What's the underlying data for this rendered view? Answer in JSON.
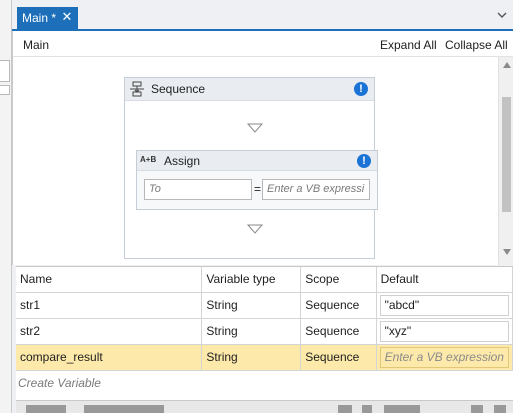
{
  "tab": {
    "label": "Main *"
  },
  "designer": {
    "breadcrumb": "Main",
    "expand_all": "Expand All",
    "collapse_all": "Collapse All"
  },
  "sequence": {
    "title": "Sequence",
    "assign": {
      "title": "Assign",
      "icon_text": "A+B",
      "to_placeholder": "To",
      "equals": "=",
      "value_placeholder": "Enter a VB expressi"
    }
  },
  "variables": {
    "columns": [
      "Name",
      "Variable type",
      "Scope",
      "Default"
    ],
    "rows": [
      {
        "name": "str1",
        "type": "String",
        "scope": "Sequence",
        "default": "\"abcd\""
      },
      {
        "name": "str2",
        "type": "String",
        "scope": "Sequence",
        "default": "\"xyz\""
      },
      {
        "name": "compare_result",
        "type": "String",
        "scope": "Sequence",
        "default": "Enter a VB expression"
      }
    ],
    "create_variable": "Create Variable"
  },
  "colors": {
    "accent": "#1c6fb8",
    "selected_row": "#fde9a9",
    "warning": "#1c73d6"
  }
}
